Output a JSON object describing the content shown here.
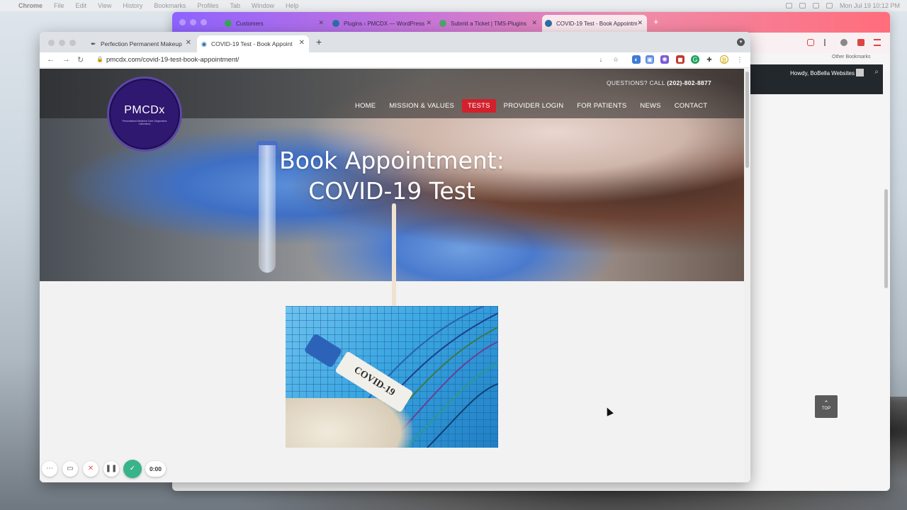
{
  "menubar": {
    "app": "Chrome",
    "items": [
      "File",
      "Edit",
      "View",
      "History",
      "Bookmarks",
      "Profiles",
      "Tab",
      "Window",
      "Help"
    ],
    "clock": "Mon Jul 19  10:12 PM"
  },
  "background_window": {
    "tabs": [
      {
        "label": "Customers",
        "favicon_color": "#3aa655"
      },
      {
        "label": "Plugins ‹ PMCDX — WordPress",
        "favicon_color": "#2b6fa8"
      },
      {
        "label": "Submit a Ticket | TMS-Plugins",
        "favicon_color": "#4aa86a"
      },
      {
        "label": "COVID-19 Test - Book Appointm",
        "favicon_color": "#2b6fa8"
      }
    ],
    "bookmarks_label": "Other Bookmarks",
    "admin_greeting": "Howdy, BoBella Websites"
  },
  "window": {
    "tabs": [
      {
        "label": "Perfection Permanent Makeup"
      },
      {
        "label": "COVID-19 Test - Book Appoint"
      }
    ],
    "url": "pmcdx.com/covid-19-test-book-appointment/"
  },
  "site": {
    "questions_label": "QUESTIONS? CALL",
    "phone": "(202)-802-8877",
    "logo_name": "PMCDx",
    "logo_tagline": "Personalized Medicine Care Diagnostics Laboratory",
    "nav": [
      "HOME",
      "MISSION & VALUES",
      "TESTS",
      "PROVIDER LOGIN",
      "FOR PATIENTS",
      "NEWS",
      "CONTACT"
    ],
    "nav_active_index": 2,
    "hero_title_line1": "Book Appointment:",
    "hero_title_line2": "COVID-19 Test",
    "image_label": "COVID-19",
    "top_button": "TOP",
    "accent_color": "#d3202c"
  },
  "recorder": {
    "time": "0:00"
  }
}
